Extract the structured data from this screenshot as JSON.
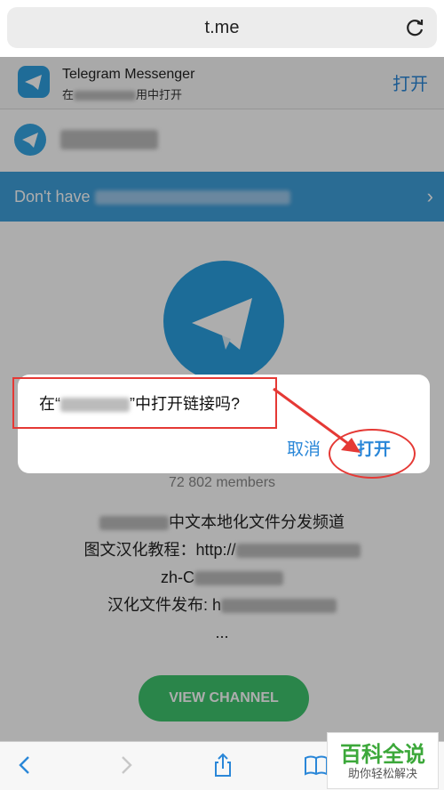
{
  "browser": {
    "url": "t.me"
  },
  "smart_banner": {
    "app_name": "Telegram Messenger",
    "subtitle_prefix": "在",
    "subtitle_suffix": "用中打开",
    "open_label": "打开"
  },
  "header": {
    "title": "Telegram"
  },
  "promo": {
    "text_prefix": "Don't have"
  },
  "channel": {
    "members": "72 802 members",
    "lines": [
      "中文本地化文件分发频道",
      "图文汉化教程：http://",
      "zh-C",
      "汉化文件发布: h",
      "..."
    ],
    "view_button": "VIEW CHANNEL"
  },
  "dialog": {
    "message_prefix": "在“",
    "message_suffix": "”中打开链接吗?",
    "cancel_label": "取消",
    "open_label": "打开"
  },
  "watermark": {
    "title": "百科全说",
    "subtitle": "助你轻松解决"
  },
  "colors": {
    "accent": "#2a87d8",
    "telegram": "#2a9fe0",
    "promo": "#3e9fda",
    "view_button": "#3ec46e",
    "annotation": "#e53935"
  }
}
